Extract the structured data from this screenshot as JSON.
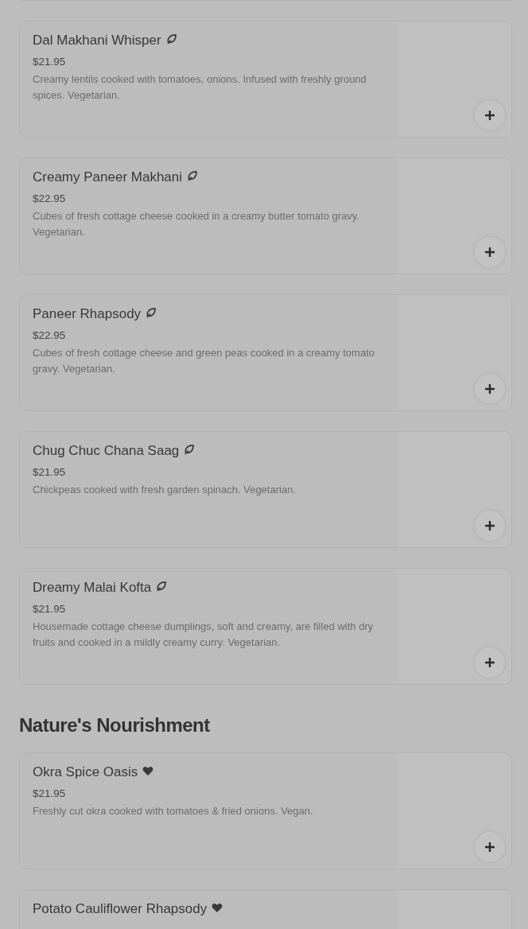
{
  "sections": [
    {
      "items": [
        {
          "name": "Dal Makhani Whisper",
          "kind": "leaf",
          "price": "$21.95",
          "description": "Creamy lentils cooked with tomatoes, onions. Infused with freshly ground spices. Vegetarian."
        },
        {
          "name": "Creamy Paneer Makhani",
          "kind": "leaf",
          "price": "$22.95",
          "description": "Cubes of fresh cottage cheese cooked in a creamy butter tomato gravy. Vegetarian."
        },
        {
          "name": "Paneer Rhapsody",
          "kind": "leaf",
          "price": "$22.95",
          "description": "Cubes of fresh cottage cheese and green peas cooked in a creamy tomato gravy. Vegetarian."
        },
        {
          "name": "Chug Chuc Chana Saag",
          "kind": "leaf",
          "price": "$21.95",
          "description": "Chickpeas cooked with fresh garden spinach. Vegetarian."
        },
        {
          "name": "Dreamy Malai Kofta",
          "kind": "leaf",
          "price": "$21.95",
          "description": "Housemade cottage cheese dumplings, soft and creamy, are filled with dry fruits and cooked in a mildly creamy curry. Vegetarian."
        }
      ]
    },
    {
      "title": "Nature's Nourishment",
      "items": [
        {
          "name": "Okra Spice Oasis",
          "kind": "heart",
          "price": "$21.95",
          "description": "Freshly cut okra cooked with tomatoes & fried onions. Vegan."
        },
        {
          "name": "Potato Cauliflower Rhapsody",
          "kind": "heart"
        }
      ]
    }
  ]
}
